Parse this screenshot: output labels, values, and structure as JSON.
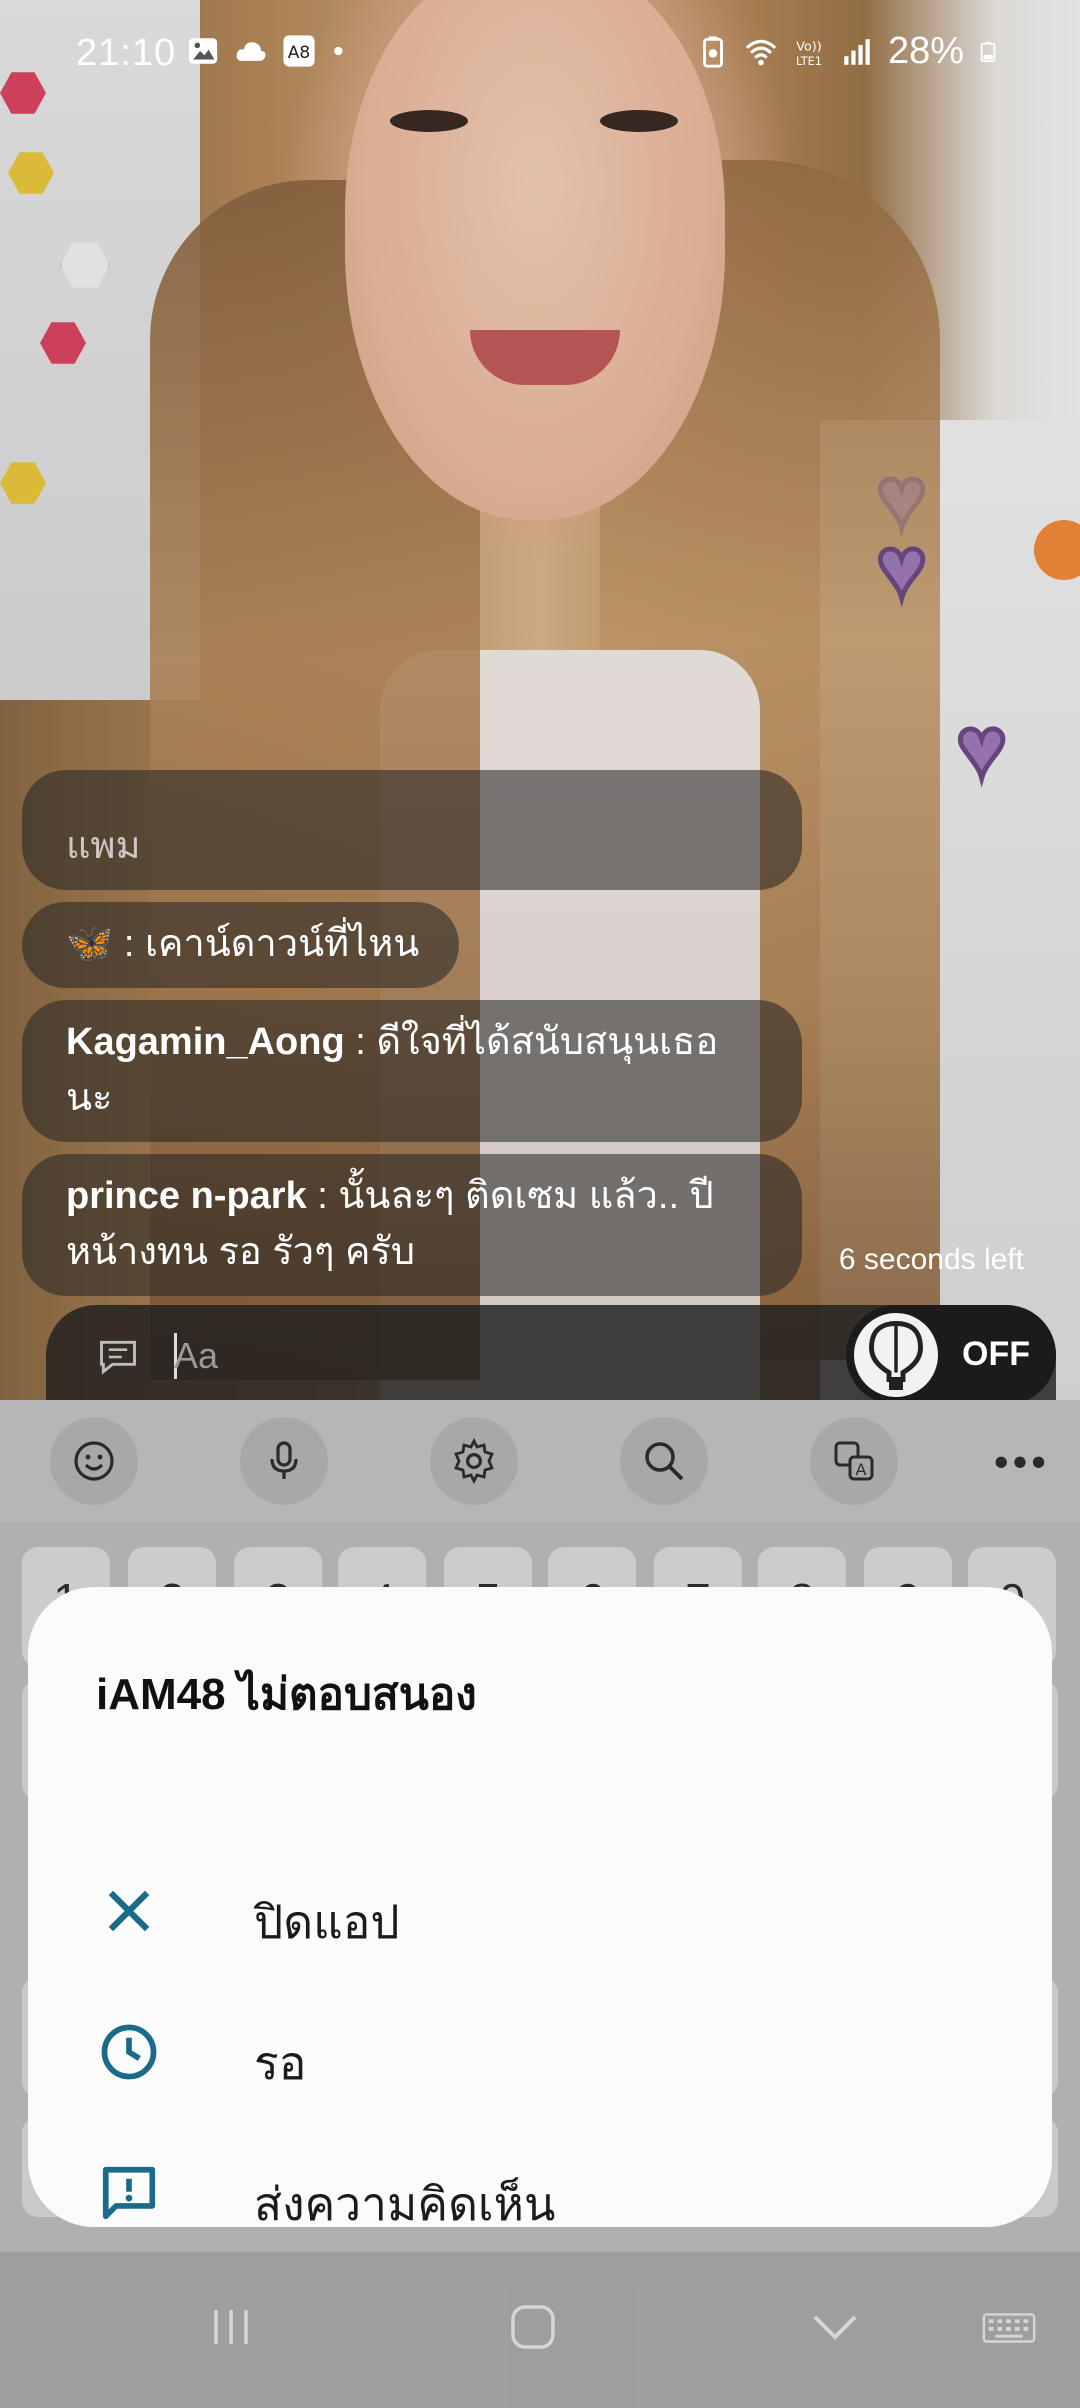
{
  "status_bar": {
    "time": "21:10",
    "battery": "28%"
  },
  "chat": {
    "partial_message": "แพม",
    "messages": [
      {
        "user": "🦋",
        "text": " : เคาน์ดาวน์ที่ไหน"
      },
      {
        "user": "Kagamin_Aong",
        "text": " : ดีใจที่ได้สนับสนุนเธอนะ"
      },
      {
        "user": "prince  n-park",
        "text": " : นั้นละๆ  ติดเซม แล้ว.. ปีหน้างทน รอ  รัวๆ ครับ"
      }
    ],
    "seconds_left": "6 seconds left"
  },
  "input": {
    "placeholder": "Aa",
    "toggle_label": "OFF"
  },
  "keyboard": {
    "number_row": [
      "1",
      "2",
      "3",
      "4",
      "5",
      "6",
      "7",
      "8",
      "9",
      "0"
    ]
  },
  "dialog": {
    "title": "iAM48 ไม่ตอบสนอง",
    "options": [
      {
        "label": "ปิดแอป",
        "icon": "close-icon"
      },
      {
        "label": "รอ",
        "icon": "clock-icon"
      },
      {
        "label": "ส่งความคิดเห็น",
        "icon": "feedback-icon"
      }
    ]
  },
  "colors": {
    "dialog_accent": "#1a6b8a",
    "dialog_bg": "#fbfbfb"
  }
}
